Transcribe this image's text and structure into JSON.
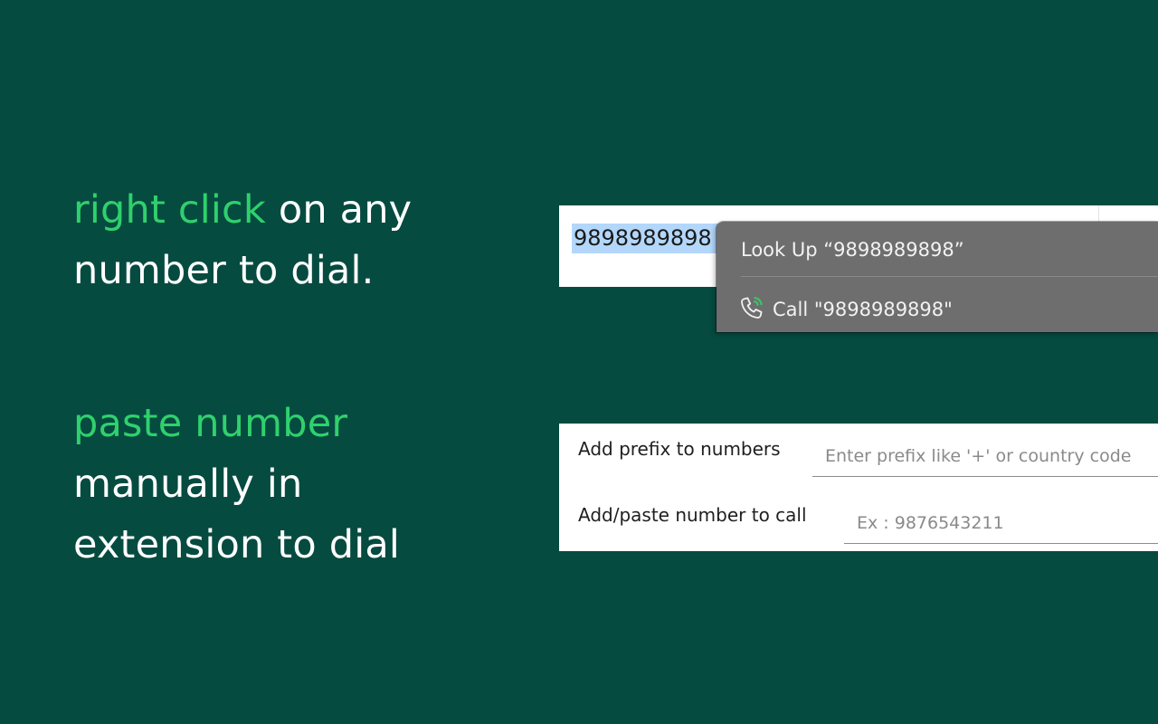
{
  "headline_1": {
    "accent": "right click",
    "rest_line1": " on any",
    "line2": "number to dial."
  },
  "headline_2": {
    "accent": "paste number",
    "line2": "manually in",
    "line3": "extension to dial"
  },
  "context_demo": {
    "selected_text": "9898989898",
    "menu": {
      "lookup_label": "Look Up “9898989898”",
      "call_label": "Call \"9898989898\"",
      "call_icon": "phone-icon"
    }
  },
  "form": {
    "prefix_label": "Add prefix to numbers",
    "prefix_placeholder": "Enter prefix like '+' or country code",
    "number_label": "Add/paste number to call",
    "number_placeholder": "Ex : 9876543211"
  },
  "colors": {
    "background": "#064b40",
    "accent": "#2fd16c",
    "selection": "#b3d7fb",
    "menu_bg": "#6e6e6e"
  }
}
